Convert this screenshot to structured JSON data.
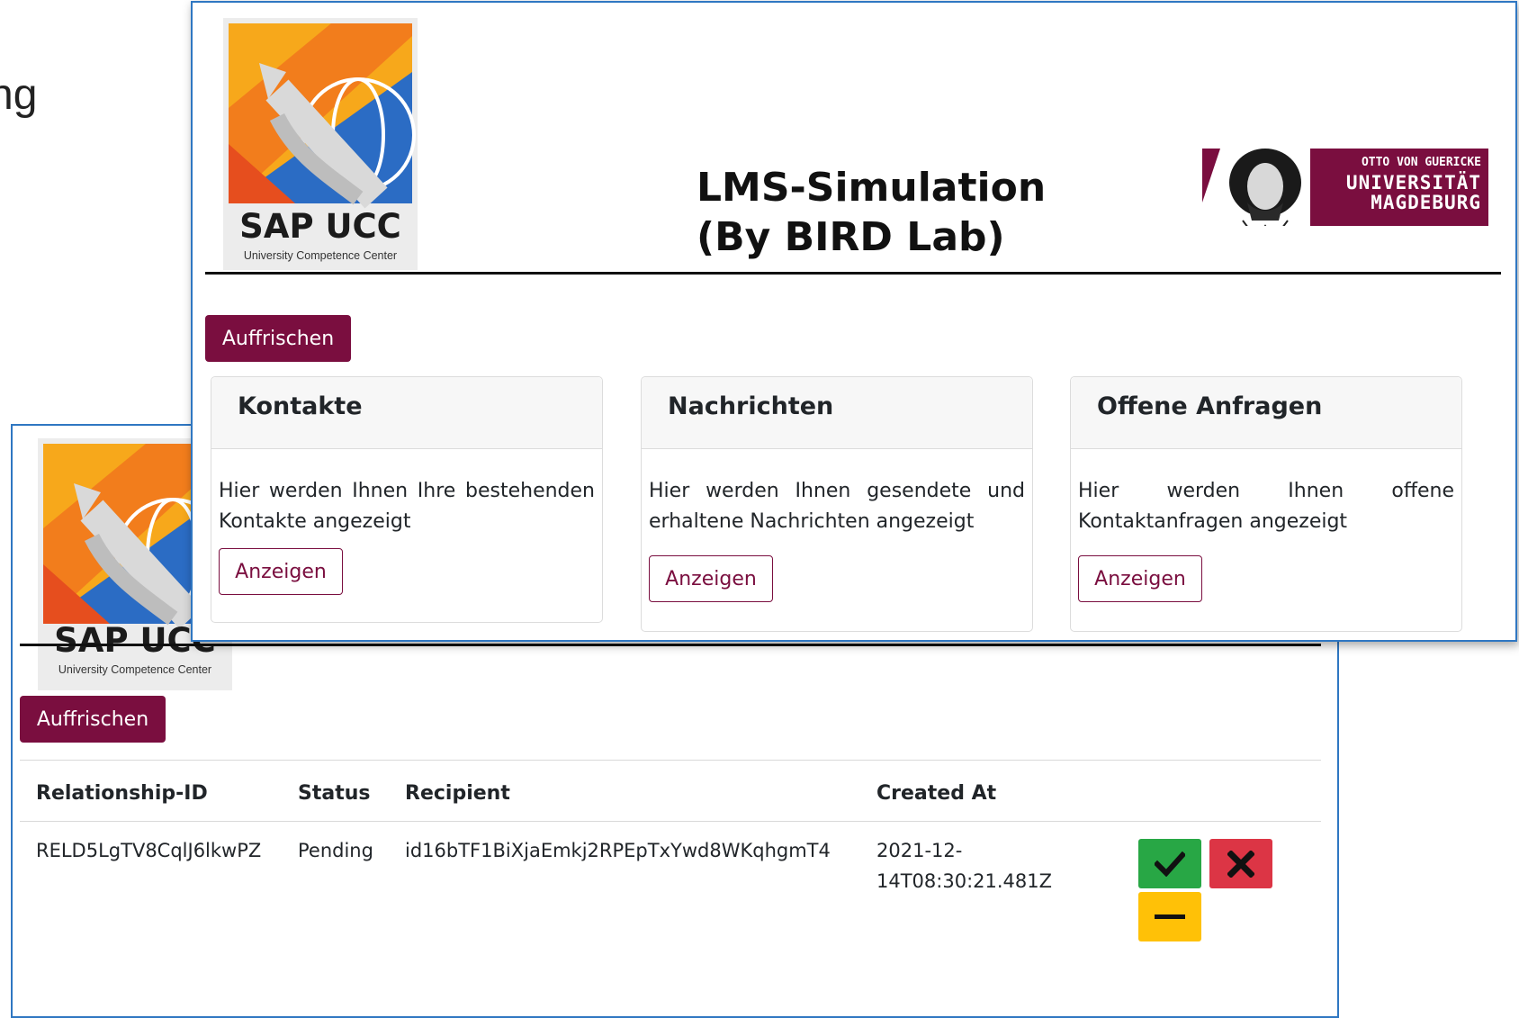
{
  "background": {
    "fragment_text": "ng"
  },
  "front": {
    "title_line1": "LMS-Simulation",
    "title_line2": "(By BIRD Lab)",
    "refresh_label": "Auffrischen",
    "sap_logo": {
      "title": "SAP UCC",
      "subtitle": "University Competence Center"
    },
    "uni_logo": {
      "line1": "OTTO VON GUERICKE",
      "line2": "UNIVERSITÄT",
      "line3": "MAGDEBURG"
    },
    "cards": [
      {
        "title": "Kontakte",
        "text_line1": "Hier werden Ihnen Ihre bestehenden",
        "text_line2": "Kontakte angezeigt",
        "button": "Anzeigen"
      },
      {
        "title": "Nachrichten",
        "text_line1": "Hier werden Ihnen gesendete und",
        "text_line2": "erhaltene Nachrichten angezeigt",
        "button": "Anzeigen"
      },
      {
        "title": "Offene Anfragen",
        "text_line1": "Hier werden Ihnen offene",
        "text_line2": "Kontaktanfragen angezeigt",
        "button": "Anzeigen"
      }
    ]
  },
  "back": {
    "refresh_label": "Auffrischen",
    "sap_logo": {
      "title": "SAP UCC",
      "subtitle": "University Competence Center"
    },
    "table": {
      "headers": [
        "Relationship-ID",
        "Status",
        "Recipient",
        "Created At"
      ],
      "rows": [
        {
          "relationship_id": "RELD5LgTV8CqlJ6lkwPZ",
          "status": "Pending",
          "recipient": "id16bTF1BiXjaEmkj2RPEpTxYwd8WKqhgmT4",
          "created_at_line1": "2021-12-",
          "created_at_line2": "14T08:30:21.481Z"
        }
      ],
      "actions": {
        "accept": "check-icon",
        "reject": "x-icon",
        "neutral": "minus-icon"
      }
    }
  },
  "colors": {
    "brand": "#7a0e3f",
    "accept": "#28a745",
    "reject": "#dc3545",
    "neutral": "#ffc107",
    "window_border": "#2f77c2"
  }
}
